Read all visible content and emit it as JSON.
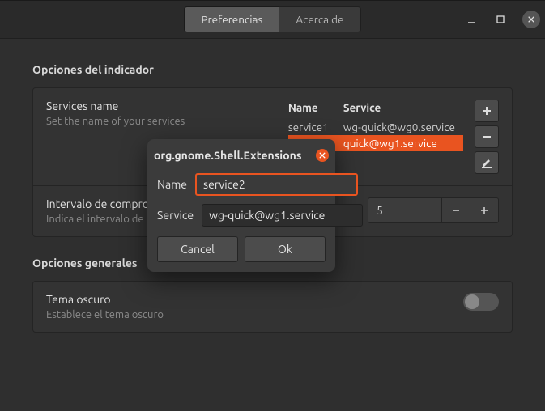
{
  "header": {
    "tabs": [
      {
        "label": "Preferencias",
        "active": true
      },
      {
        "label": "Acerca de",
        "active": false
      }
    ]
  },
  "indicator": {
    "title": "Opciones del indicador",
    "services": {
      "row_title": "Services name",
      "row_sub": "Set the name of your services",
      "columns": {
        "name": "Name",
        "service": "Service"
      },
      "rows": [
        {
          "name": "service1",
          "service": "wg-quick@wg0.service",
          "selected": false
        },
        {
          "name": "",
          "service": "quick@wg1.service",
          "selected": true
        }
      ]
    },
    "interval": {
      "row_title": "Intervalo de comprobación",
      "row_sub": "Indica el intervalo de comprobación de WireGuard",
      "value": "5"
    }
  },
  "general": {
    "title": "Opciones generales",
    "dark": {
      "row_title": "Tema oscuro",
      "row_sub": "Establece el tema oscuro",
      "enabled": false
    }
  },
  "dialog": {
    "title": "org.gnome.Shell.Extensions",
    "fields": {
      "name_label": "Name",
      "name_value": "service2",
      "service_label": "Service",
      "service_value": "wg-quick@wg1.service"
    },
    "actions": {
      "cancel": "Cancel",
      "ok": "Ok"
    }
  }
}
